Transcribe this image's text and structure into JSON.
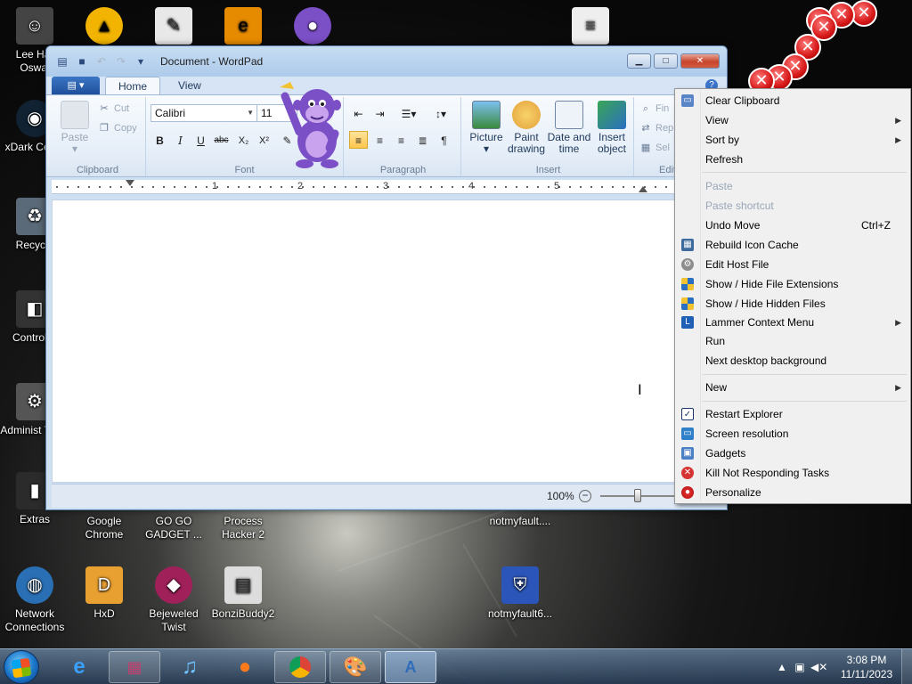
{
  "wordpad": {
    "title": "Document - WordPad",
    "tabs": [
      "Home",
      "View"
    ],
    "clipboard": {
      "paste": "Paste",
      "cut": "Cut",
      "copy": "Copy",
      "label": "Clipboard"
    },
    "font": {
      "family": "Calibri",
      "size": "11",
      "label": "Font"
    },
    "paragraph": {
      "label": "Paragraph"
    },
    "insert": {
      "picture": "Picture",
      "paint_drawing": "Paint drawing",
      "date_time": "Date and time",
      "insert_object": "Insert object",
      "label": "Insert"
    },
    "editing": {
      "find": "Fin",
      "replace": "Rep",
      "select": "Sel",
      "label": "Edit"
    },
    "ruler_numbers": [
      "1",
      "2",
      "3",
      "4",
      "5"
    ],
    "zoom": "100%"
  },
  "context_menu": {
    "items": [
      {
        "label": "Clear Clipboard",
        "icon": "clipboard-icon"
      },
      {
        "label": "View",
        "submenu": true
      },
      {
        "label": "Sort by",
        "submenu": true
      },
      {
        "label": "Refresh"
      },
      {
        "label": "Paste",
        "disabled": true
      },
      {
        "label": "Paste shortcut",
        "disabled": true
      },
      {
        "label": "Undo Move",
        "shortcut": "Ctrl+Z"
      },
      {
        "label": "Rebuild Icon Cache",
        "icon": "icon-cache-icon"
      },
      {
        "label": "Edit Host File",
        "icon": "gear-icon"
      },
      {
        "label": "Show / Hide File Extensions",
        "icon": "shield-icon"
      },
      {
        "label": "Show / Hide Hidden Files",
        "icon": "shield-icon"
      },
      {
        "label": "Lammer Context Menu",
        "icon": "lammer-icon",
        "submenu": true
      },
      {
        "label": "Run"
      },
      {
        "label": "Next desktop background"
      },
      {
        "label": "New",
        "submenu": true
      },
      {
        "label": "Restart Explorer",
        "icon": "checkbox-icon"
      },
      {
        "label": "Screen resolution",
        "icon": "monitor-icon"
      },
      {
        "label": "Gadgets",
        "icon": "gadgets-icon"
      },
      {
        "label": "Kill Not Responding Tasks",
        "icon": "kill-icon"
      },
      {
        "label": "Personalize",
        "icon": "personalize-icon"
      }
    ]
  },
  "desktop_icons": {
    "lee": "Lee Har Oswal",
    "xdark": "xDark Cente",
    "recycle": "Recycle",
    "control": "Control P",
    "admin": "Administ Tools",
    "extras": "Extras",
    "network": "Network Connections",
    "chrome": "Google Chrome",
    "gogo": "GO GO GADGET ...",
    "process": "Process Hacker 2",
    "notmyfault_top": "notmyfault....",
    "hxd": "HxD",
    "bejeweled": "Bejeweled Twist",
    "bonzi": "BonziBuddy2",
    "notmyfault_bottom": "notmyfault6..."
  },
  "taskbar": {
    "time": "3:08 PM",
    "date": "11/11/2023"
  },
  "colors": {
    "accent": "#1f4f9a",
    "taskbar": "#2c4560",
    "bonzi_purple": "#7b4fc6"
  }
}
